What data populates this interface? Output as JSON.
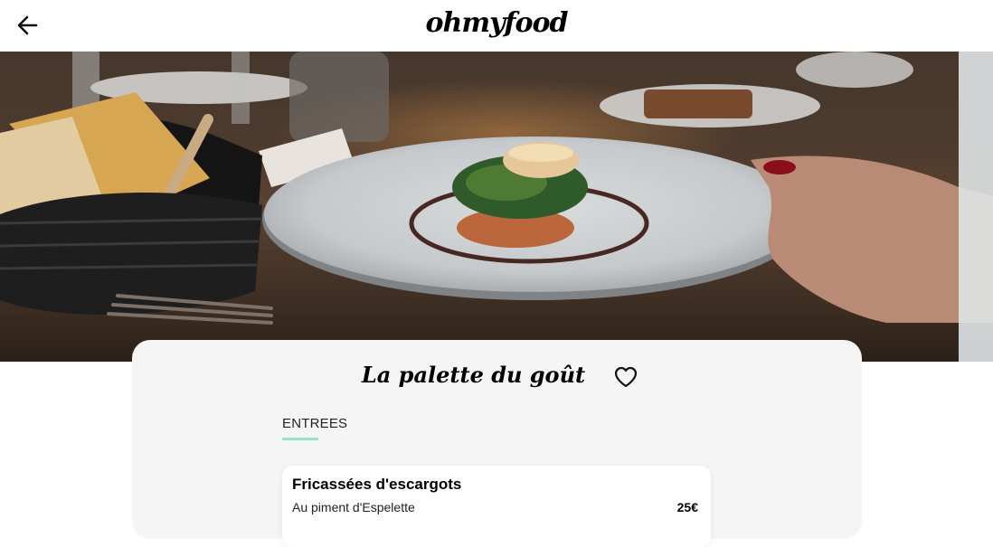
{
  "header": {
    "logo_text": "ohmyfood",
    "back_icon": "arrow-left-icon"
  },
  "restaurant": {
    "name": "La palette du goût",
    "favorite_icon": "heart-outline-icon"
  },
  "menu": {
    "sections": [
      {
        "label": "ENTREES",
        "underline_color": "#99e2d0",
        "dishes": [
          {
            "name": "Fricassées d'escargots",
            "description": "Au piment d'Espelette",
            "price": "25€"
          }
        ]
      }
    ]
  },
  "colors": {
    "accent": "#99e2d0",
    "card_background": "#f5f5f5",
    "text": "#000000"
  }
}
